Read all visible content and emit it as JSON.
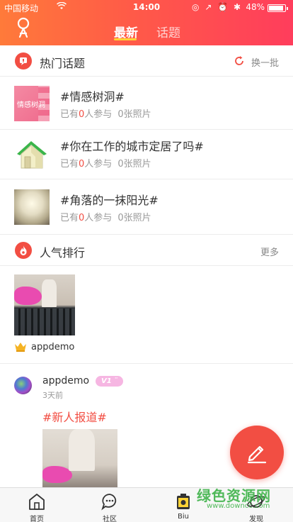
{
  "status_bar": {
    "carrier": "中国移动",
    "wifi_icon": "wifi-icon",
    "time": "14:00",
    "right_icons": "◎ ↗ ⏰ ✱",
    "battery_pct": "48%"
  },
  "header": {
    "tabs": [
      {
        "label": "最新",
        "active": true
      },
      {
        "label": "话题",
        "active": false
      }
    ],
    "accent": "#ffd335",
    "gradient": [
      "#ff7a3a",
      "#ff3d5c"
    ]
  },
  "hot_topics": {
    "title": "热门话题",
    "action": "换一批",
    "items": [
      {
        "title": "#情感树洞#",
        "meta_prefix": "已有",
        "count": "0",
        "meta_suffix": "人参与",
        "photos": "0张照片",
        "thumb_text": "情感树洞"
      },
      {
        "title": "#你在工作的城市定居了吗#",
        "meta_prefix": "已有",
        "count": "0",
        "meta_suffix": "人参与",
        "photos": "0张照片"
      },
      {
        "title": "#角落的一抹阳光#",
        "meta_prefix": "已有",
        "count": "0",
        "meta_suffix": "人参与",
        "photos": "0张照片"
      }
    ]
  },
  "ranking": {
    "title": "人气排行",
    "action": "更多",
    "top_user": "appdemo"
  },
  "post": {
    "user": "appdemo",
    "badge": "V1 ¨",
    "time": "3天前",
    "tag": "#新人报道#"
  },
  "bottom_nav": [
    {
      "label": "首页"
    },
    {
      "label": "社区"
    },
    {
      "label": "Biu"
    },
    {
      "label": "发现"
    }
  ],
  "watermark": {
    "text": "绿色资源网",
    "url": "www.downcc.com"
  },
  "colors": {
    "brand_red": "#f24e43",
    "text": "#333333",
    "muted": "#999999"
  }
}
